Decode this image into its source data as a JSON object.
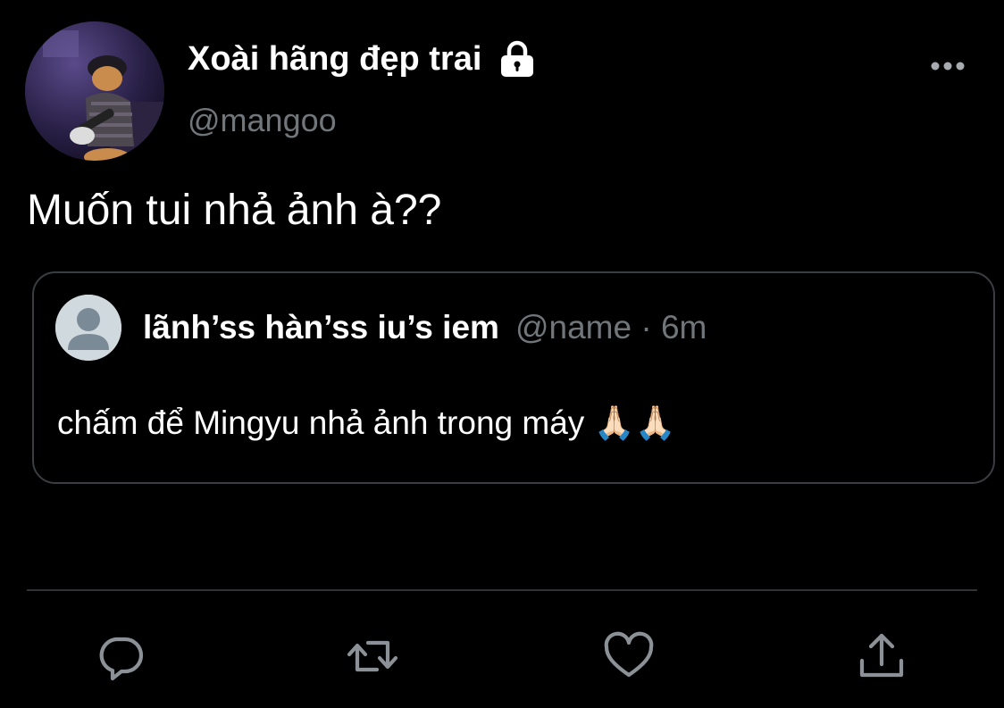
{
  "tweet": {
    "author": {
      "display_name": "Xoài hãng đẹp trai",
      "handle": "@mangoo",
      "protected_icon": "lock-icon"
    },
    "text": "Muốn tui nhả ảnh à??",
    "more_icon": "more-horizontal-icon"
  },
  "quote": {
    "author": {
      "display_name": "lãnh’ss hàn’ss iu’s iem",
      "handle": "@name",
      "separator": "·",
      "time": "6m"
    },
    "text": "chấm để Mingyu nhả ảnh trong máy",
    "emoji": "🙏🏻🙏🏻"
  },
  "actions": [
    {
      "name": "reply",
      "icon": "reply-icon"
    },
    {
      "name": "retweet",
      "icon": "retweet-icon"
    },
    {
      "name": "like",
      "icon": "heart-icon"
    },
    {
      "name": "share",
      "icon": "share-icon"
    }
  ],
  "colors": {
    "background": "#000000",
    "text_primary": "#ffffff",
    "text_secondary": "#71767b",
    "border": "#3a3d41",
    "divider": "#2f3336",
    "icon": "#71767b"
  }
}
